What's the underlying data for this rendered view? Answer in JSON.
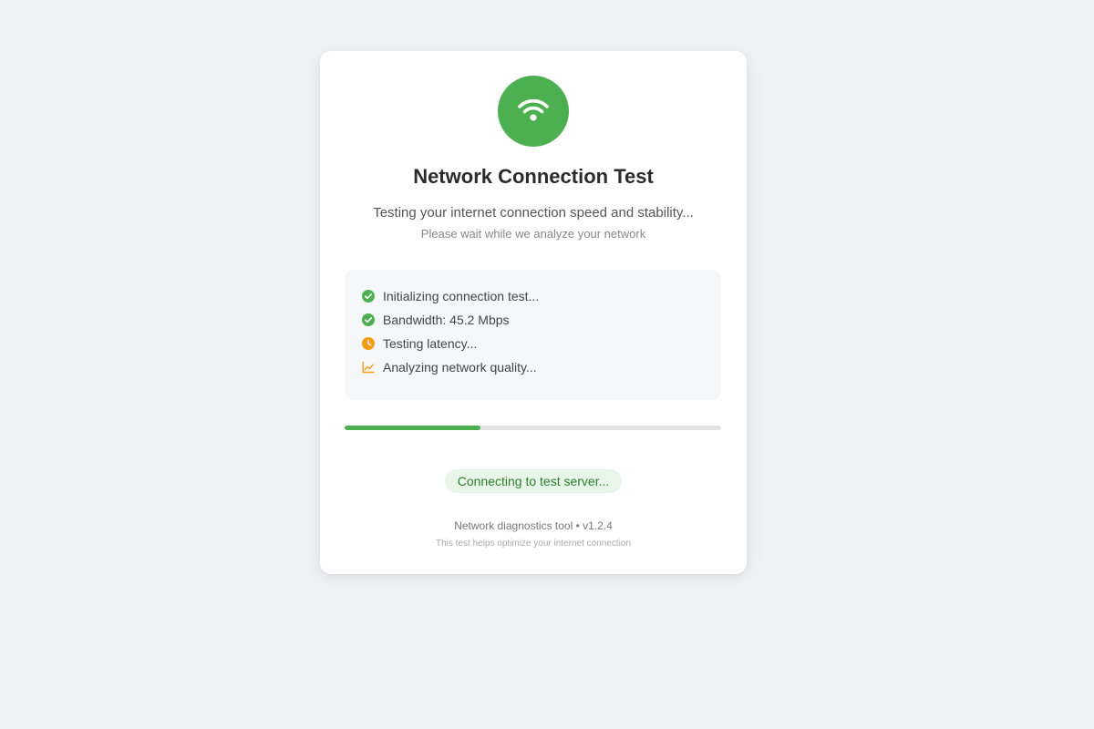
{
  "header": {
    "icon": "wifi-icon",
    "title": "Network Connection Test",
    "subtitle": "Testing your internet connection speed and stability...",
    "note": "Please wait while we analyze your network"
  },
  "status_items": [
    {
      "icon": "check-circle-icon",
      "label": "Initializing connection test...",
      "color": "#4caf50"
    },
    {
      "icon": "check-circle-icon",
      "label": "Bandwidth: 45.2 Mbps",
      "color": "#4caf50"
    },
    {
      "icon": "clock-icon",
      "label": "Testing latency...",
      "color": "#f39c12"
    },
    {
      "icon": "chart-line-icon",
      "label": "Analyzing network quality...",
      "color": "#f39c12"
    }
  ],
  "progress": {
    "fraction": 0.36,
    "color": "#4caf50"
  },
  "status_pill": {
    "label": "Connecting to test server..."
  },
  "footer": {
    "main": "Network diagnostics tool • v1.2.4",
    "sub": "This test helps optimize your internet connection"
  },
  "colors": {
    "accent": "#4caf50",
    "warning": "#f39c12",
    "background": "#f0f1f4"
  }
}
